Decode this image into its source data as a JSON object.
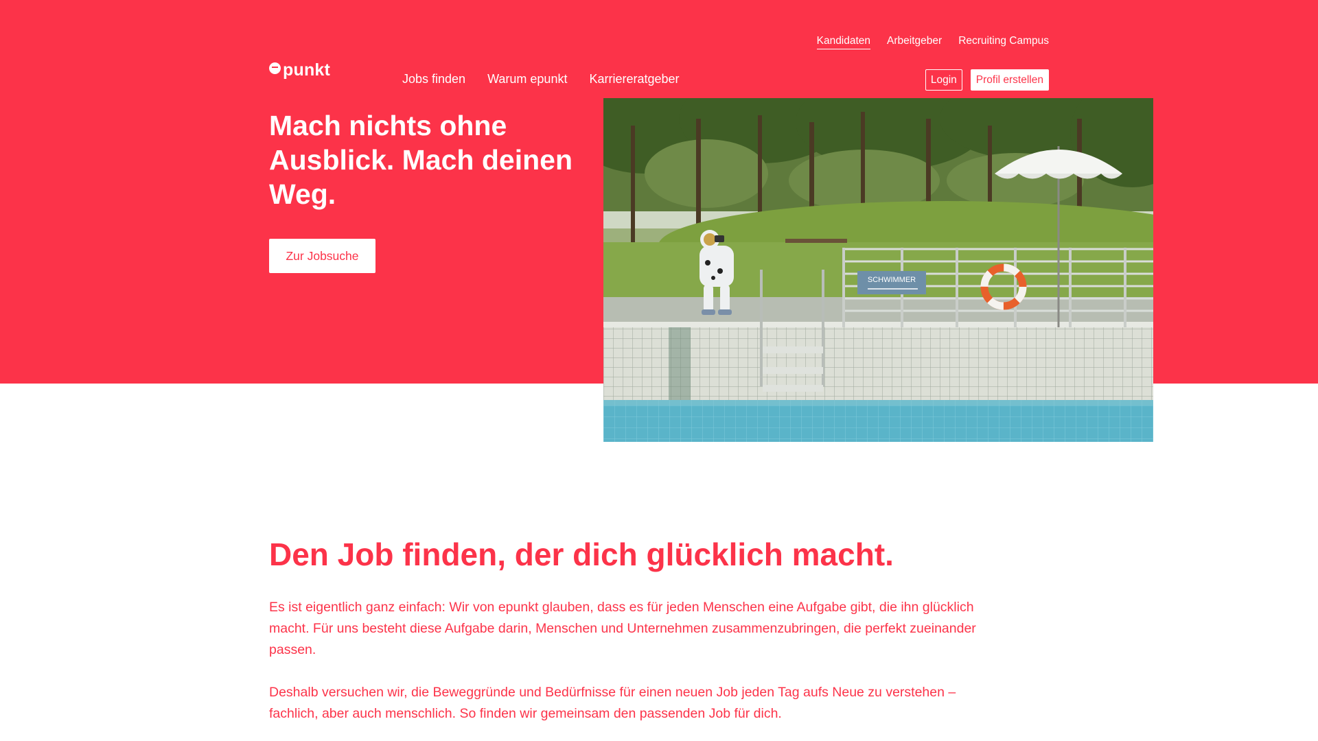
{
  "brand": {
    "name": "epunkt",
    "logo_text": "punkt",
    "color_primary": "#fc3349",
    "color_white": "#ffffff"
  },
  "topnav": {
    "items": [
      {
        "label": "Kandidaten",
        "active": true
      },
      {
        "label": "Arbeitgeber",
        "active": false
      },
      {
        "label": "Recruiting Campus",
        "active": false
      }
    ]
  },
  "mainnav": {
    "items": [
      {
        "label": "Jobs finden"
      },
      {
        "label": "Warum epunkt"
      },
      {
        "label": "Karriereratgeber"
      }
    ]
  },
  "auth": {
    "login_label": "Login",
    "profile_label": "Profil erstellen"
  },
  "hero": {
    "title": "Mach nichts ohne Ausblick. Mach deinen Weg.",
    "cta_label": "Zur Jobsuche",
    "image_sign_text": "SCHWIMMER",
    "image_icon": "astronaut-at-pool-photo"
  },
  "intro": {
    "title": "Den Job finden, der dich glücklich macht.",
    "paragraph_1": "Es ist eigentlich ganz einfach: Wir von epunkt glauben, dass es für jeden Menschen eine Aufgabe gibt, die ihn glücklich macht. Für uns besteht diese Aufgabe darin, Menschen und Unternehmen zusammenzubringen, die perfekt zueinander passen.",
    "paragraph_2": "Deshalb versuchen wir, die Beweggründe und Bedürfnisse für einen neuen Job jeden Tag aufs Neue zu verstehen – fachlich, aber auch menschlich. So finden wir gemeinsam den passenden Job für dich."
  }
}
